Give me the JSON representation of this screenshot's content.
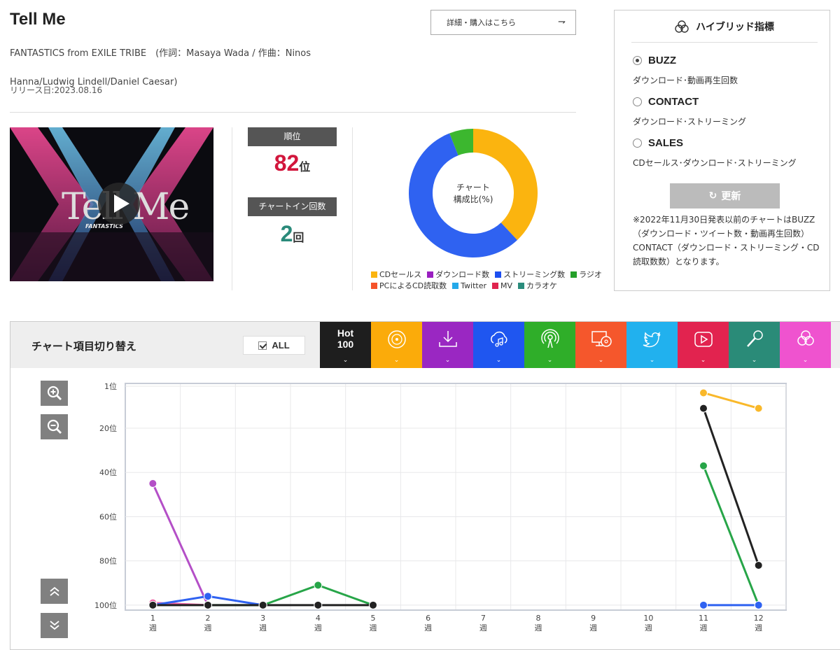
{
  "song": {
    "title": "Tell Me",
    "credits": "FANTASTICS from EXILE TRIBE　(作詞：Masaya Wada / 作曲：Ninos Hanna/Ludwig Lindell/Daniel Caesar)",
    "release": "リリース日:2023.08.16",
    "buy_label": "詳細・購入はこちら",
    "jacket_text": "Tell Me",
    "jacket_subtext": "FANTASTICS"
  },
  "stats": {
    "rank_label": "順位",
    "rank_value": "82",
    "rank_unit": "位",
    "chartin_label": "チャートイン回数",
    "chartin_value": "2",
    "chartin_unit": "回"
  },
  "composition": {
    "center_line1": "チャート",
    "center_line2": "構成比(%)",
    "slices": [
      {
        "name": "CDセールス",
        "value": 38,
        "color": "#fbb40f"
      },
      {
        "name": "ストリーミング数",
        "value": 56,
        "color": "#2f62f1"
      },
      {
        "name": "ラジオ",
        "value": 6,
        "color": "#3cb72f"
      }
    ],
    "legend": [
      {
        "name": "CDセールス",
        "color": "#fbb40f"
      },
      {
        "name": "ダウンロード数",
        "color": "#9a1fc0"
      },
      {
        "name": "ストリーミング数",
        "color": "#1d4ff0"
      },
      {
        "name": "ラジオ",
        "color": "#25a02a"
      },
      {
        "name": "PCによるCD読取数",
        "color": "#f5532a"
      },
      {
        "name": "Twitter",
        "color": "#24a9ea"
      },
      {
        "name": "MV",
        "color": "#e0244e"
      },
      {
        "name": "カラオケ",
        "color": "#2a8c7c"
      }
    ]
  },
  "hybrid": {
    "title": "ハイブリッド指標",
    "options": [
      {
        "name": "BUZZ",
        "desc": "ダウンロード･動画再生回数",
        "selected": true
      },
      {
        "name": "CONTACT",
        "desc": "ダウンロード･ストリーミング",
        "selected": false
      },
      {
        "name": "SALES",
        "desc": "CDセールス･ダウンロード･ストリーミング",
        "selected": false
      }
    ],
    "update_label": "更新",
    "note": "※2022年11月30日発表以前のチャートはBUZZ（ダウンロード・ツイート数・動画再生回数）CONTACT（ダウンロード・ストリーミング・CD読取数数）となります。"
  },
  "switcher": {
    "title": "チャート項目切り替え",
    "all_label": "ALL",
    "tabs": [
      {
        "name": "hot100",
        "label": "Hot 100",
        "color": "#1e1e1e",
        "icon": "hot-text"
      },
      {
        "name": "cd-sales",
        "label": "",
        "color": "#fbab0a",
        "icon": "disc-icon"
      },
      {
        "name": "download",
        "label": "",
        "color": "#9a27c2",
        "icon": "download-icon"
      },
      {
        "name": "streaming",
        "label": "",
        "color": "#1f56f0",
        "icon": "cloud-music-icon"
      },
      {
        "name": "radio",
        "label": "",
        "color": "#2fae29",
        "icon": "radio-icon"
      },
      {
        "name": "pc-cd-read",
        "label": "",
        "color": "#f5572c",
        "icon": "pc-disc-icon"
      },
      {
        "name": "twitter",
        "label": "",
        "color": "#21b1ee",
        "icon": "twitter-icon"
      },
      {
        "name": "mv",
        "label": "",
        "color": "#e2234f",
        "icon": "play-icon"
      },
      {
        "name": "karaoke",
        "label": "",
        "color": "#2a8b78",
        "icon": "mic-icon"
      },
      {
        "name": "hybrid",
        "label": "",
        "color": "#ef53cf",
        "icon": "hybrid-icon"
      }
    ]
  },
  "chart_data": {
    "type": "line",
    "x": [
      1,
      2,
      3,
      4,
      5,
      6,
      7,
      8,
      9,
      10,
      11,
      12
    ],
    "x_tick_labels": [
      "1\n週",
      "2\n週",
      "3\n週",
      "4\n週",
      "5\n週",
      "6\n週",
      "7\n週",
      "8\n週",
      "9\n週",
      "10\n週",
      "11\n週",
      "12\n週"
    ],
    "y_ticks": [
      "1位",
      "20位",
      "40位",
      "60位",
      "80位",
      "100位"
    ],
    "y_tick_values": [
      1,
      20,
      40,
      60,
      80,
      100
    ],
    "ylim": [
      1,
      101
    ],
    "y_inverted": true,
    "grid": true,
    "series": [
      {
        "color": "#b44fc7",
        "points": [
          [
            1,
            45
          ],
          [
            2,
            100
          ]
        ]
      },
      {
        "color": "#ef5fa4",
        "points": [
          [
            1,
            99
          ],
          [
            2,
            100
          ]
        ]
      },
      {
        "color": "#27a548",
        "points": [
          [
            2,
            100
          ],
          [
            3,
            100
          ],
          [
            4,
            91
          ],
          [
            5,
            100
          ]
        ]
      },
      {
        "color": "#27a548",
        "points": [
          [
            11,
            37
          ],
          [
            12,
            100
          ]
        ]
      },
      {
        "color": "#2f62f1",
        "points": [
          [
            1,
            100
          ],
          [
            2,
            96
          ],
          [
            3,
            100
          ]
        ]
      },
      {
        "color": "#2f62f1",
        "points": [
          [
            11,
            100
          ],
          [
            12,
            100
          ]
        ]
      },
      {
        "color": "#f9b82a",
        "points": [
          [
            11,
            4
          ],
          [
            12,
            11
          ]
        ]
      },
      {
        "color": "#222222",
        "points": [
          [
            1,
            100
          ],
          [
            2,
            100
          ],
          [
            3,
            100
          ],
          [
            4,
            100
          ],
          [
            5,
            100
          ]
        ]
      },
      {
        "color": "#222222",
        "points": [
          [
            11,
            11
          ],
          [
            12,
            82
          ]
        ]
      }
    ]
  }
}
